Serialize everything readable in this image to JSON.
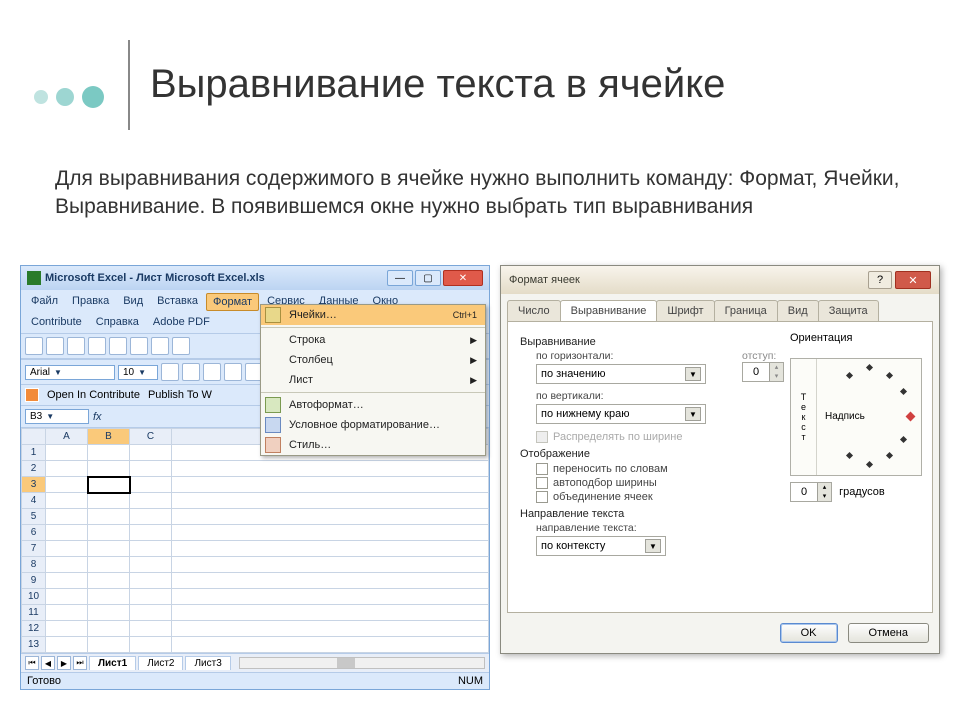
{
  "slide": {
    "title": "Выравнивание текста в ячейке",
    "body": "Для выравнивания содержимого в ячейке нужно выполнить команду: Формат, Ячейки, Выравнивание. В появившемся окне нужно выбрать тип выравнивания"
  },
  "excel": {
    "title": "Microsoft Excel - Лист Microsoft Excel.xls",
    "menu": [
      "Файл",
      "Правка",
      "Вид",
      "Вставка",
      "Формат",
      "Сервис",
      "Данные",
      "Окно"
    ],
    "menu2": [
      "Contribute",
      "Справка",
      "Adobe PDF"
    ],
    "font": "Arial",
    "fontSize": "10",
    "contribute_open": "Open In Contribute",
    "contribute_publish": "Publish To W",
    "namebox": "B3",
    "fx": "fx",
    "columns": [
      "A",
      "B",
      "C"
    ],
    "sheets": [
      "Лист1",
      "Лист2",
      "Лист3"
    ],
    "status_ready": "Готово",
    "status_num": "NUM"
  },
  "dropdown": {
    "cells": "Ячейки…",
    "cells_shortcut": "Ctrl+1",
    "row": "Строка",
    "column": "Столбец",
    "sheet": "Лист",
    "autoformat": "Автоформат…",
    "condformat": "Условное форматирование…",
    "style": "Стиль…"
  },
  "dialog": {
    "title": "Формат ячеек",
    "tabs": [
      "Число",
      "Выравнивание",
      "Шрифт",
      "Граница",
      "Вид",
      "Защита"
    ],
    "grp_align": "Выравнивание",
    "lbl_horiz": "по горизонтали:",
    "val_horiz": "по значению",
    "lbl_vert": "по вертикали:",
    "val_vert": "по нижнему краю",
    "indent_label": "отступ:",
    "indent_value": "0",
    "chk_distribute": "Распределять по ширине",
    "grp_display": "Отображение",
    "chk_wrap": "переносить по словам",
    "chk_shrink": "автоподбор ширины",
    "chk_merge": "объединение ячеек",
    "grp_textdir": "Направление текста",
    "lbl_textdir": "направление текста:",
    "val_textdir": "по контексту",
    "grp_orient": "Ориентация",
    "orient_vtext": [
      "Т",
      "е",
      "к",
      "с",
      "т"
    ],
    "orient_caption": "Надпись",
    "degrees_value": "0",
    "degrees_label": "градусов",
    "btn_ok": "OK",
    "btn_cancel": "Отмена"
  }
}
